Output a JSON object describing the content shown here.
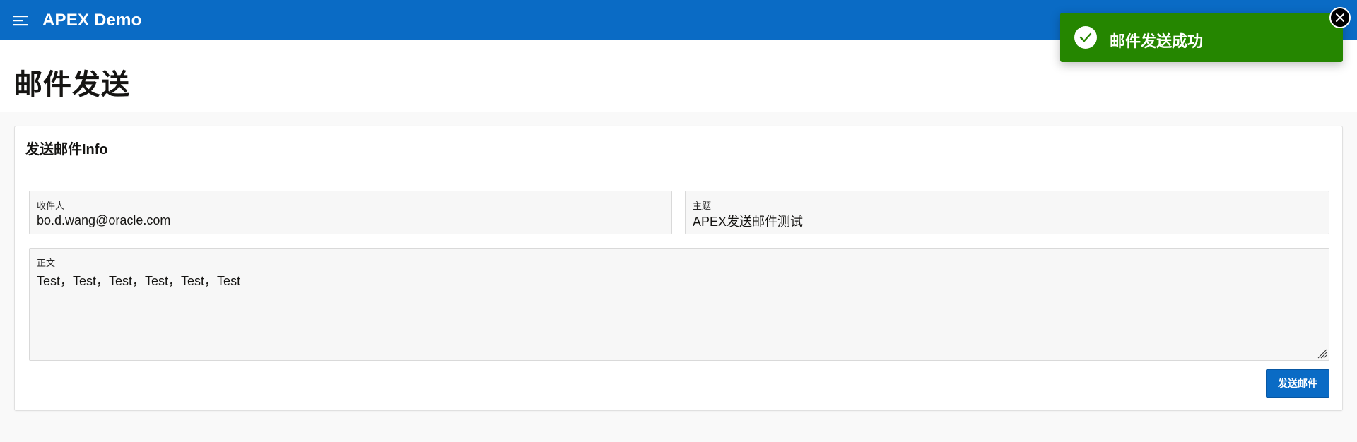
{
  "header": {
    "app_title": "APEX Demo",
    "menu_icon": "hamburger-menu-icon",
    "color": "#0a6bc5"
  },
  "page": {
    "title": "邮件发送"
  },
  "region": {
    "title": "发送邮件Info"
  },
  "form": {
    "recipient": {
      "label": "收件人",
      "value": "bo.d.wang@oracle.com"
    },
    "subject": {
      "label": "主题",
      "value": "APEX发送邮件测试"
    },
    "body": {
      "label": "正文",
      "value": "Test，Test，Test，Test，Test，Test"
    }
  },
  "buttons": {
    "send_label": "发送邮件"
  },
  "toast": {
    "message": "邮件发送成功",
    "icon": "check-circle-icon",
    "close_icon": "close-icon",
    "color": "#258600"
  }
}
